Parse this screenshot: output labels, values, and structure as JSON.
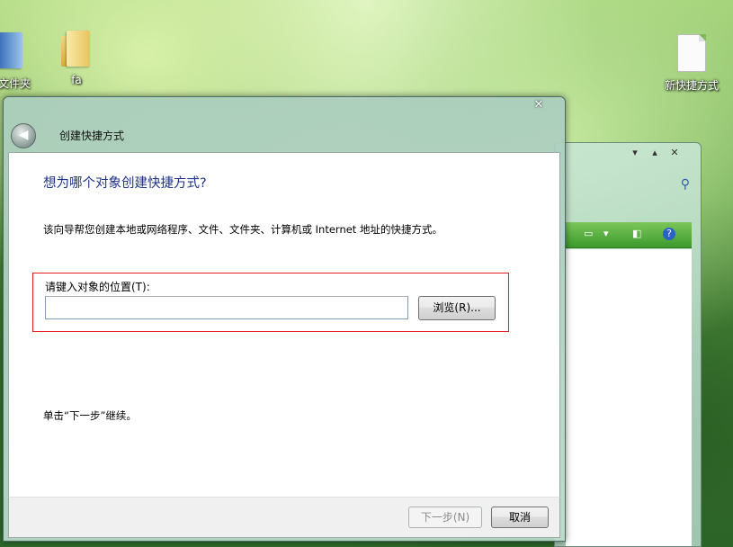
{
  "desktop": {
    "icons": [
      {
        "label": "建文件夹"
      },
      {
        "label": "fa"
      },
      {
        "label": "新快捷方式"
      }
    ]
  },
  "dialog": {
    "title": "创建快捷方式",
    "close_glyph": "✕",
    "back_glyph": "◀",
    "heading": "想为哪个对象创建快捷方式?",
    "description": "该向导帮您创建本地或网络程序、文件、文件夹、计算机或 Internet 地址的快捷方式。",
    "location_label": "请键入对象的位置(T):",
    "location_value": "",
    "browse_label": "浏览(R)...",
    "hint": "单击“下一步”继续。",
    "next_label": "下一步(N)",
    "cancel_label": "取消",
    "highlight_color": "#e02020",
    "heading_color": "#1e3287"
  }
}
